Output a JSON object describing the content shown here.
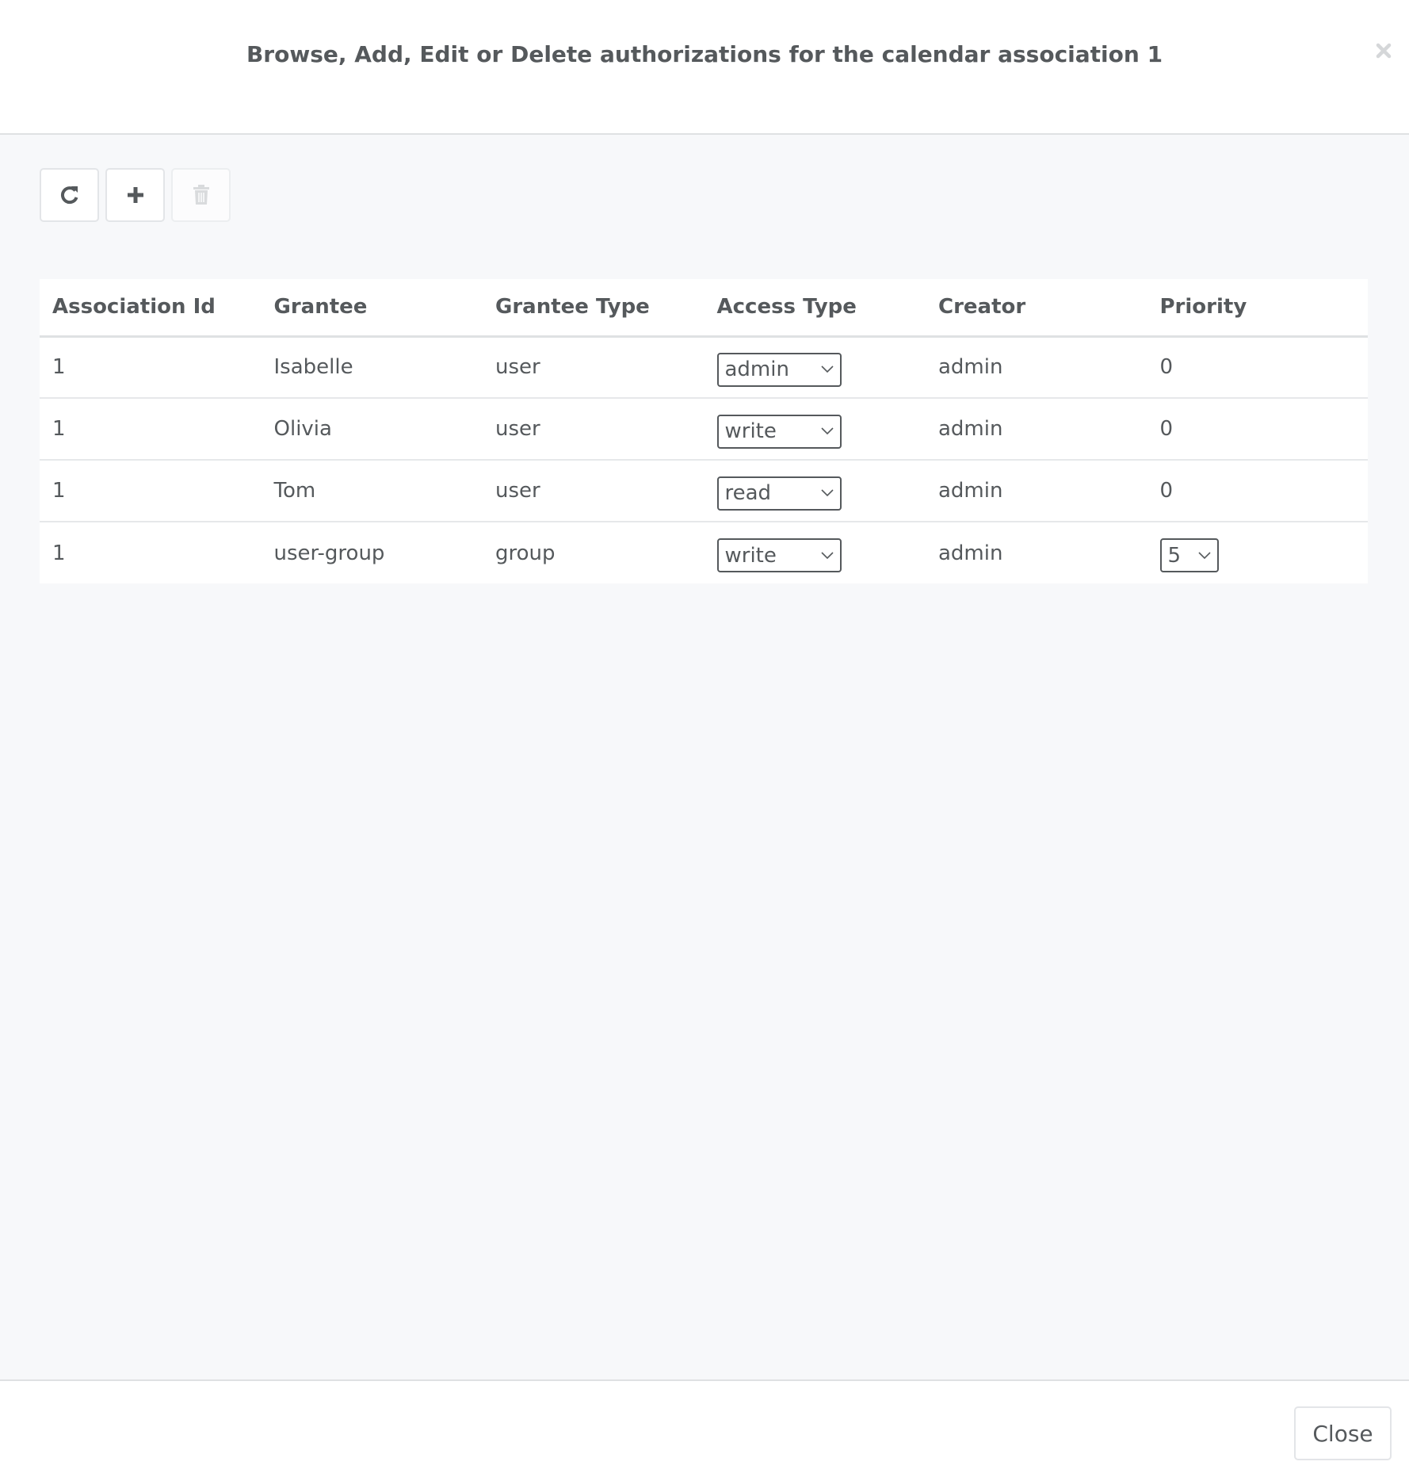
{
  "header": {
    "title": "Browse, Add, Edit or Delete authorizations for the calendar association 1",
    "close_icon": "close-x-icon"
  },
  "toolbar": {
    "buttons": [
      {
        "name": "refresh",
        "icon": "refresh-icon",
        "enabled": true
      },
      {
        "name": "add",
        "icon": "plus-icon",
        "enabled": true
      },
      {
        "name": "delete",
        "icon": "trash-icon",
        "enabled": false
      }
    ]
  },
  "table": {
    "columns": [
      "Association Id",
      "Grantee",
      "Grantee Type",
      "Access Type",
      "Creator",
      "Priority"
    ],
    "rows": [
      {
        "association_id": "1",
        "grantee": "Isabelle",
        "grantee_type": "user",
        "access_type": "admin",
        "creator": "admin",
        "priority": "0",
        "priority_editable": false
      },
      {
        "association_id": "1",
        "grantee": "Olivia",
        "grantee_type": "user",
        "access_type": "write",
        "creator": "admin",
        "priority": "0",
        "priority_editable": false
      },
      {
        "association_id": "1",
        "grantee": "Tom",
        "grantee_type": "user",
        "access_type": "read",
        "creator": "admin",
        "priority": "0",
        "priority_editable": false
      },
      {
        "association_id": "1",
        "grantee": "user-group",
        "grantee_type": "group",
        "access_type": "write",
        "creator": "admin",
        "priority": "5",
        "priority_editable": true
      }
    ]
  },
  "footer": {
    "close_label": "Close"
  }
}
